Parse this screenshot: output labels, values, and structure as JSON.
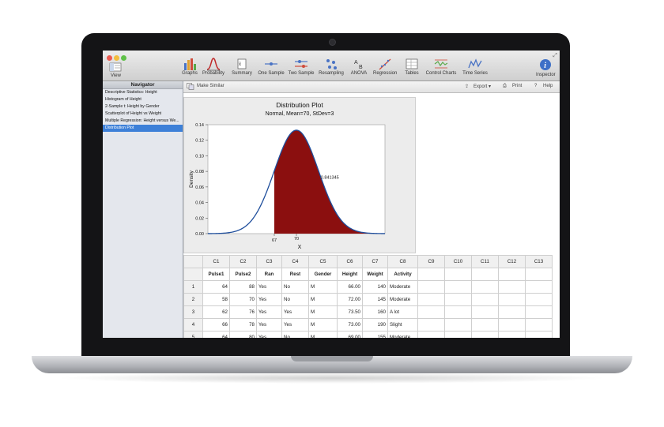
{
  "toolbar": {
    "view_label": "View",
    "buttons": [
      {
        "label": "Graphs",
        "icon": "bar-chart-icon"
      },
      {
        "label": "Probability",
        "icon": "bell-curve-icon"
      },
      {
        "label": "Summary",
        "icon": "summary-stats-icon"
      },
      {
        "label": "One Sample",
        "icon": "one-sample-icon"
      },
      {
        "label": "Two Sample",
        "icon": "two-sample-icon"
      },
      {
        "label": "Resampling",
        "icon": "resampling-icon"
      },
      {
        "label": "ANOVA",
        "icon": "anova-icon"
      },
      {
        "label": "Regression",
        "icon": "regression-icon"
      },
      {
        "label": "Tables",
        "icon": "tables-icon"
      },
      {
        "label": "Control Charts",
        "icon": "control-chart-icon"
      },
      {
        "label": "Time Series",
        "icon": "time-series-icon"
      }
    ],
    "inspector_label": "Inspector"
  },
  "navigator": {
    "title": "Navigator",
    "items": [
      "Descriptive Statistics: Height",
      "Histogram of Height",
      "2-Sample t: Height by Gender",
      "Scatterplot of Height vs Weight",
      "Multiple Regression: Height versus We...",
      "Distribution Plot"
    ],
    "selected_index": 5
  },
  "subbar": {
    "make_similar": "Make Similar",
    "export": "Export",
    "print": "Print",
    "help": "Help"
  },
  "chart_data": {
    "type": "area",
    "title": "Distribution Plot",
    "subtitle": "Normal, Mean=70, StDev=3",
    "xlabel": "X",
    "ylabel": "Density",
    "mean": 70,
    "stdev": 3,
    "xlim": [
      58,
      82
    ],
    "ylim": [
      0,
      0.14
    ],
    "yticks": [
      "0.00",
      "0.02",
      "0.04",
      "0.06",
      "0.08",
      "0.10",
      "0.12",
      "0.14"
    ],
    "xticks": [
      "67",
      "70"
    ],
    "shaded_from": 67,
    "shaded_label": "0.841345",
    "curve_color": "#1f4e9c",
    "fill_color": "#8b0f0f"
  },
  "worksheet": {
    "columns": [
      "C1",
      "C2",
      "C3",
      "C4",
      "C5",
      "C6",
      "C7",
      "C8",
      "C9",
      "C10",
      "C11",
      "C12",
      "C13"
    ],
    "names": [
      "Pulse1",
      "Pulse2",
      "Ran",
      "Rest",
      "Gender",
      "Height",
      "Weight",
      "Activity",
      "",
      "",
      "",
      "",
      ""
    ],
    "rows": [
      [
        "64",
        "88",
        "Yes",
        "No",
        "M",
        "66.00",
        "140",
        "Moderate"
      ],
      [
        "58",
        "70",
        "Yes",
        "No",
        "M",
        "72.00",
        "145",
        "Moderate"
      ],
      [
        "62",
        "76",
        "Yes",
        "Yes",
        "M",
        "73.50",
        "160",
        "A lot"
      ],
      [
        "66",
        "78",
        "Yes",
        "Yes",
        "M",
        "73.00",
        "190",
        "Slight"
      ],
      [
        "64",
        "80",
        "Yes",
        "No",
        "M",
        "69.00",
        "155",
        "Moderate"
      ]
    ]
  },
  "colors": {
    "accent": "#3d80d8",
    "traffic_red": "#ec5b52",
    "traffic_yellow": "#f2bd3e",
    "traffic_green": "#5fc148"
  }
}
